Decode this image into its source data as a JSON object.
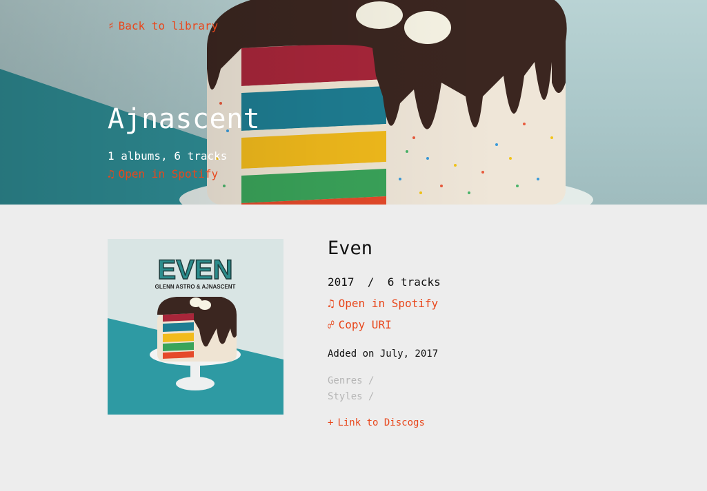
{
  "nav": {
    "back_icon": "sharp-sign-icon",
    "back_glyph": "♯",
    "back_label": "Back to library"
  },
  "artist": {
    "name": "Ajnascent",
    "stats": "1 albums, 6 tracks",
    "spotify_glyph": "♫",
    "spotify_label": "Open in Spotify"
  },
  "album": {
    "title": "Even",
    "year": "2017",
    "separator": "/",
    "tracks": "6 tracks",
    "spotify_glyph": "♫",
    "spotify_label": "Open in Spotify",
    "link_glyph": "☍",
    "copy_label": "Copy URI",
    "added": "Added on July, 2017",
    "genres_label": "Genres /",
    "styles_label": "Styles /",
    "plus_glyph": "+",
    "discogs_label": "Link to Discogs",
    "cover": {
      "title_text": "EVEN",
      "artists_text": "GLENN ASTRO & AJNASCENT"
    }
  },
  "colors": {
    "accent": "#e8471c",
    "background": "#ededed",
    "muted": "#b5b5b5"
  }
}
